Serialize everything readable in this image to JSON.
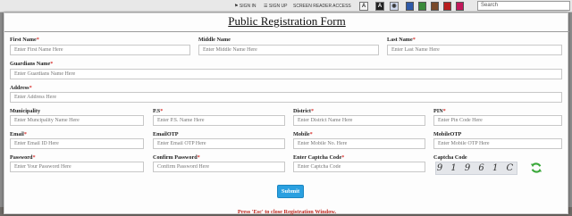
{
  "topbar": {
    "signin": "SIGN IN",
    "signup": "SIGN UP",
    "screen_reader": "SCREEN READER ACCESS",
    "text_size_label": "A",
    "contrast_label": "A",
    "search_placeholder": "Search",
    "swatch_colors": [
      "#2e5aa8",
      "#3a8a3a",
      "#7a4a2a",
      "#b81e1e",
      "#c2185b"
    ]
  },
  "form": {
    "title": "Public Registration Form",
    "fields": {
      "first_name": {
        "label": "First Name",
        "placeholder": "Enter First Name Here"
      },
      "middle_name": {
        "label": "Middle Name",
        "placeholder": "Enter Middle Name Here"
      },
      "last_name": {
        "label": "Last Name",
        "placeholder": "Enter Last Name Here"
      },
      "guardian": {
        "label": "Guardians Name",
        "placeholder": "Enter Guardians Name Here"
      },
      "address": {
        "label": "Address",
        "placeholder": "Enter Address Here"
      },
      "municipality": {
        "label": "Municipality",
        "placeholder": "Enter Muncipality Name Here"
      },
      "ps": {
        "label": "P.S",
        "placeholder": "Enter P.S. Name Here"
      },
      "district": {
        "label": "District",
        "placeholder": "Enter District Name Here"
      },
      "pin": {
        "label": "PIN",
        "placeholder": "Enter Pin Code Here"
      },
      "email": {
        "label": "Email",
        "placeholder": "Enter Email ID Here"
      },
      "email_otp": {
        "label": "EmailOTP",
        "placeholder": "Enter Email OTP Here"
      },
      "mobile": {
        "label": "Mobile",
        "placeholder": "Enter Mobile No. Here"
      },
      "mobile_otp": {
        "label": "MobileOTP",
        "placeholder": "Enter Mobile OTP Here"
      },
      "password": {
        "label": "Password",
        "placeholder": "Enter Your Password Here"
      },
      "confirm_password": {
        "label": "Confirm Password",
        "placeholder": "Confirm Password Here"
      },
      "captcha_code_input": {
        "label": "Enter Captcha Code",
        "placeholder": "Enter Captcha Code"
      },
      "captcha": {
        "label": "Captcha Code",
        "value": "91961C"
      }
    },
    "required_mark": "*",
    "submit_label": "Submit",
    "close_note": "Press 'Esc' to close Registration Window."
  }
}
